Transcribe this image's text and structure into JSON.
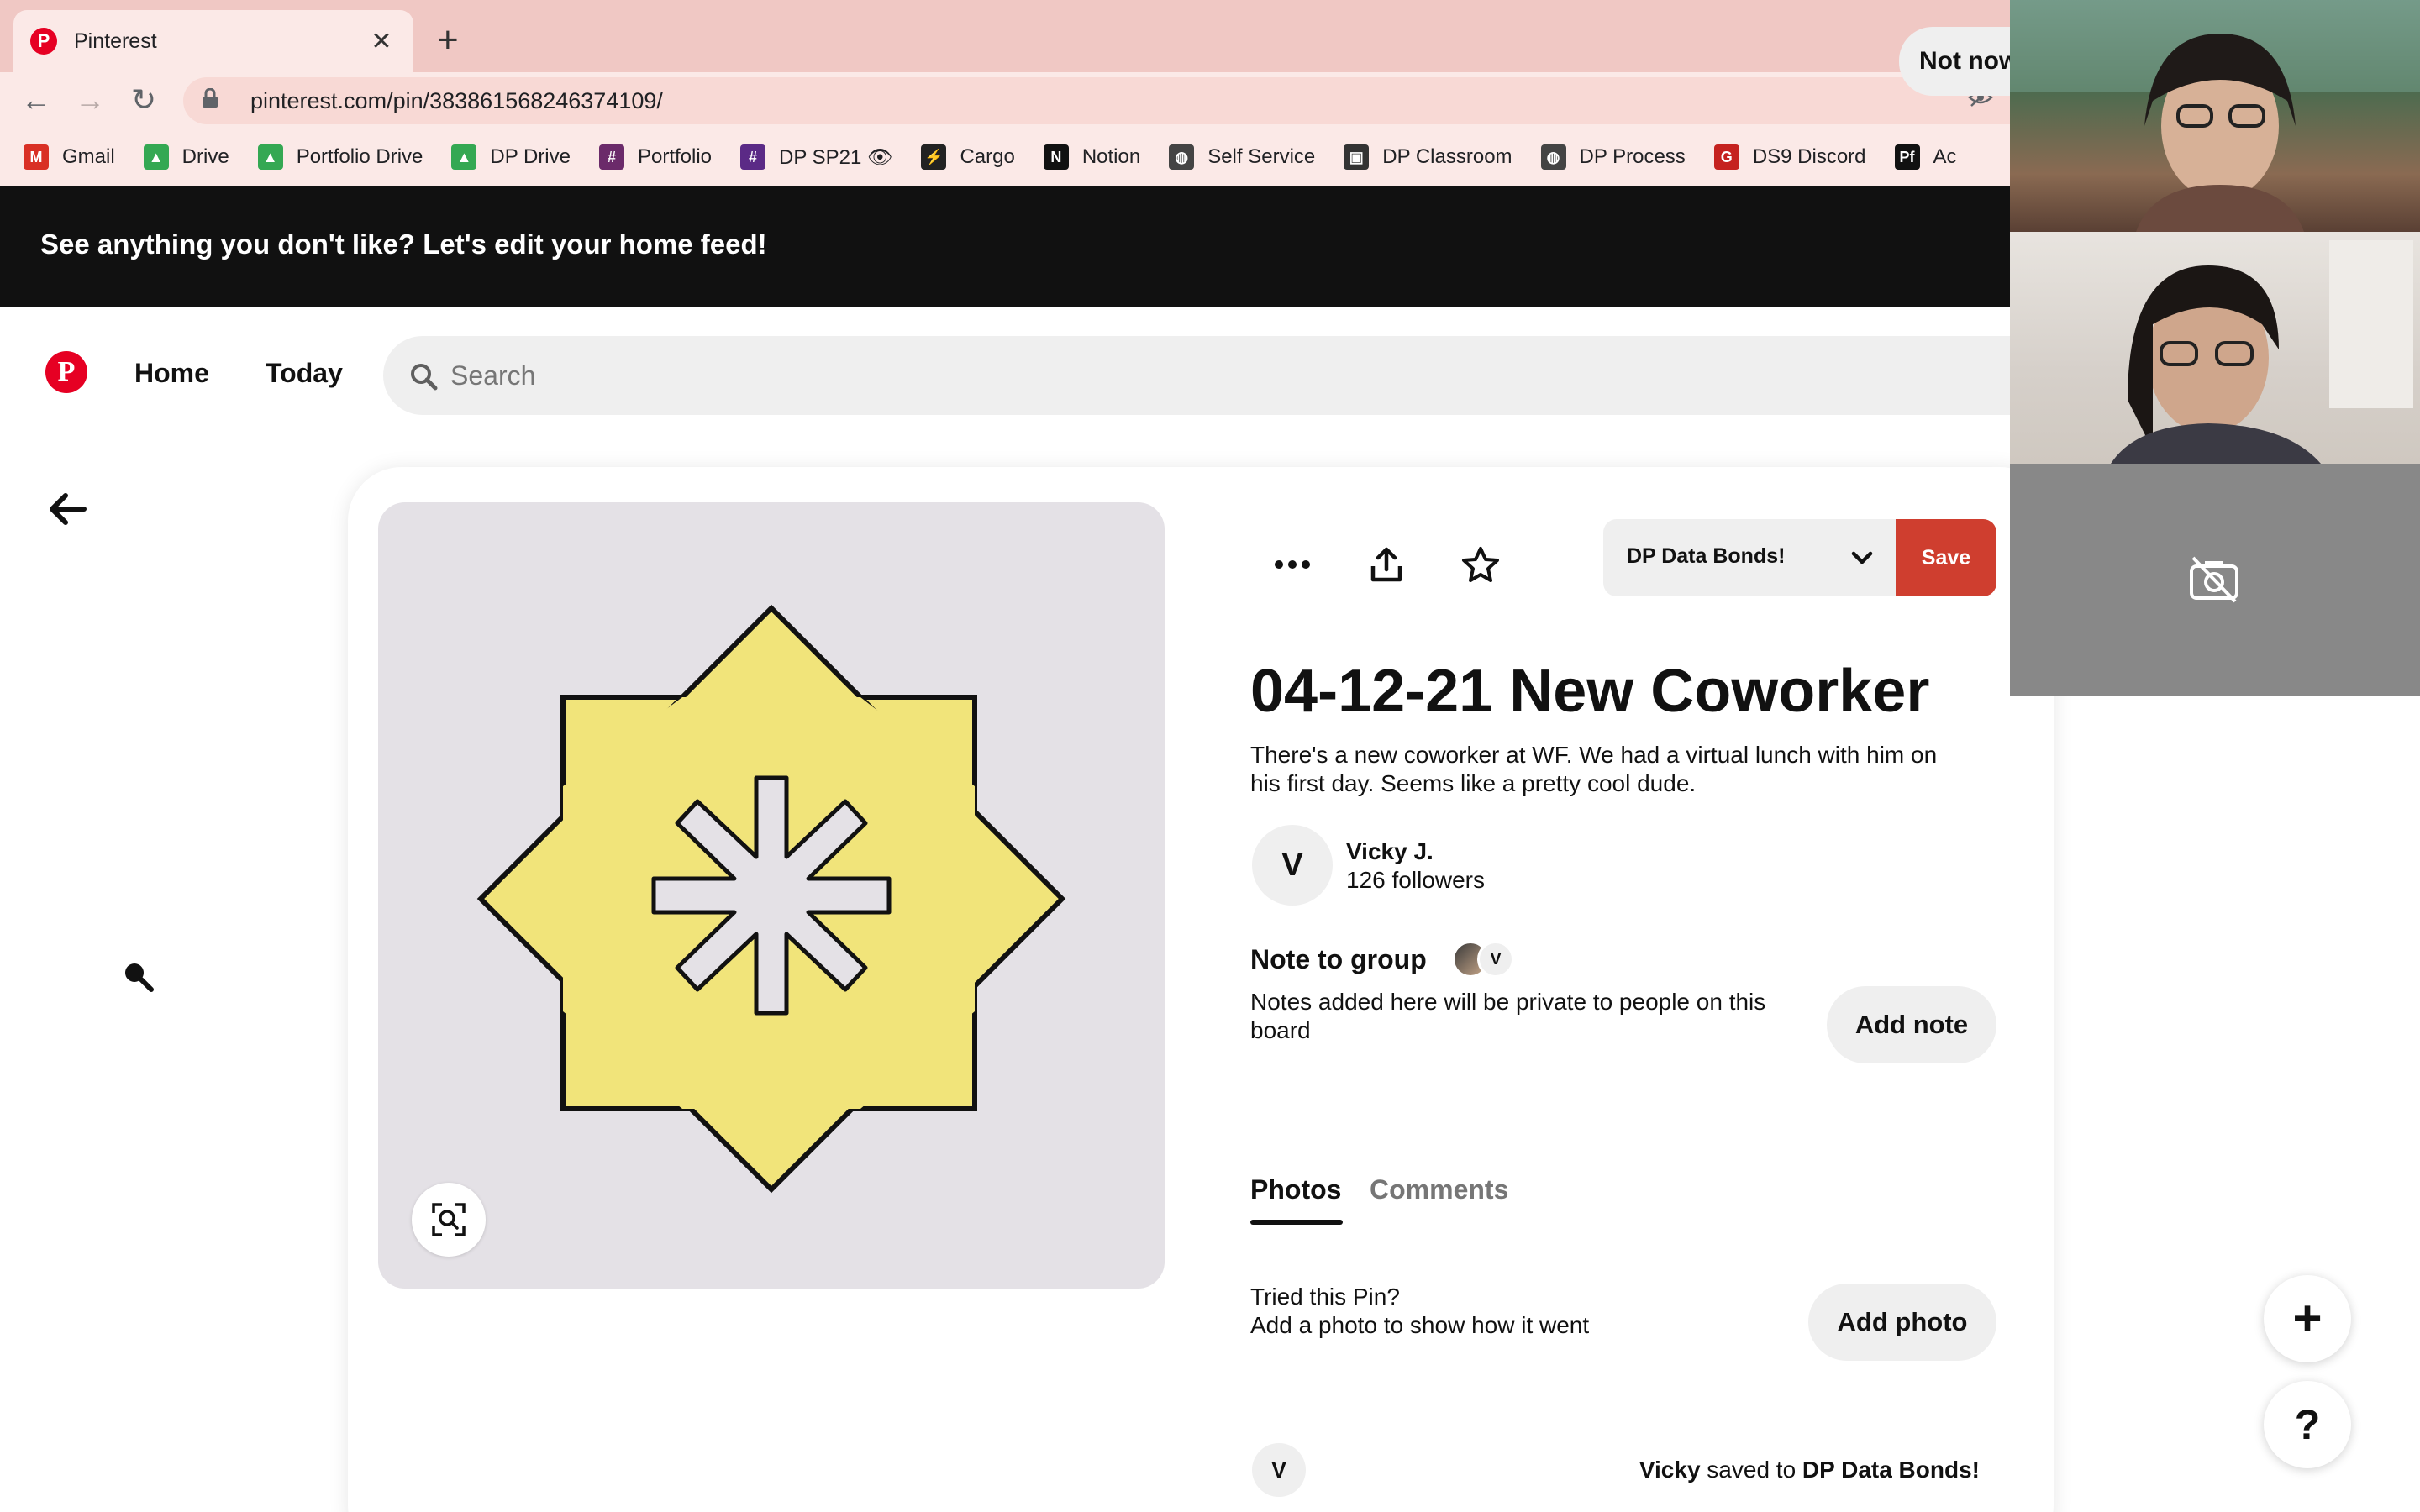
{
  "browser": {
    "tab_title": "Pinterest",
    "new_tab_symbol": "+",
    "close_symbol": "✕",
    "url": "pinterest.com/pin/383861568246374109/",
    "bookmarks": [
      {
        "label": "Gmail",
        "icon": "gmail-icon",
        "color": "#d93025",
        "glyph": "M"
      },
      {
        "label": "Drive",
        "icon": "google-drive-icon",
        "color": "#34a853",
        "glyph": "▲"
      },
      {
        "label": "Portfolio Drive",
        "icon": "google-drive-icon",
        "color": "#34a853",
        "glyph": "▲"
      },
      {
        "label": "DP Drive",
        "icon": "google-drive-icon",
        "color": "#34a853",
        "glyph": "▲"
      },
      {
        "label": "Portfolio",
        "icon": "portfolio-icon",
        "color": "#6b2a6a",
        "glyph": "#"
      },
      {
        "label": "DP SP21 👁",
        "icon": "dp-sp21-icon",
        "color": "#5b2a86",
        "glyph": "#"
      },
      {
        "label": "Cargo",
        "icon": "cargo-bolt-icon",
        "color": "#222222",
        "glyph": "⚡"
      },
      {
        "label": "Notion",
        "icon": "notion-icon",
        "color": "#111111",
        "glyph": "N"
      },
      {
        "label": "Self Service",
        "icon": "globe-icon",
        "color": "#444444",
        "glyph": "◍"
      },
      {
        "label": "DP Classroom",
        "icon": "classroom-icon",
        "color": "#333333",
        "glyph": "▣"
      },
      {
        "label": "DP Process",
        "icon": "globe-icon",
        "color": "#444444",
        "glyph": "◍"
      },
      {
        "label": "DS9 Discord",
        "icon": "discord-icon",
        "color": "#c5221f",
        "glyph": "G"
      },
      {
        "label": "Ac",
        "icon": "pf-icon",
        "color": "#111111",
        "glyph": "Pf"
      }
    ]
  },
  "banner": {
    "text": "See anything you don't like? Let's edit your home feed!",
    "button": "Not now"
  },
  "header": {
    "logo": "P",
    "nav": [
      "Home",
      "Today"
    ],
    "search_placeholder": "Search"
  },
  "pin": {
    "board_name": "DP Data Bonds!",
    "save_label": "Save",
    "title": "04-12-21 New Coworker",
    "description": "There's a new coworker at WF. We had a virtual lunch with him on his first day. Seems like a pretty cool dude.",
    "creator": {
      "initial": "V",
      "name": "Vicky J.",
      "followers": "126 followers"
    },
    "note": {
      "heading": "Note to group",
      "member_initial": "V",
      "description": "Notes added here will be private to people on this board",
      "button": "Add note"
    },
    "tabs": [
      "Photos",
      "Comments"
    ],
    "tried": {
      "title": "Tried this Pin?",
      "subtitle": "Add a photo to show how it went",
      "button": "Add photo"
    },
    "activity": {
      "initial": "V",
      "user": "Vicky",
      "middle": " saved to ",
      "board": "DP Data Bonds!"
    }
  },
  "colors": {
    "brand": "#e60023",
    "save": "#cf3e2f",
    "star_fill": "#f1e47a",
    "image_bg": "#e4e1e6"
  },
  "fab": {
    "plus": "+",
    "help": "?"
  }
}
